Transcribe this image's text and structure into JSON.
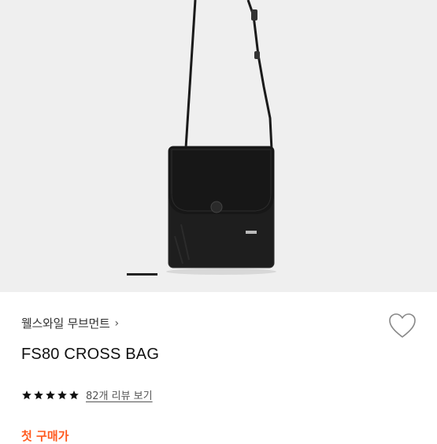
{
  "product": {
    "brand": "웰스와일 무브먼트",
    "brand_chevron": "›",
    "name": "FS80 CROSS BAG",
    "rating_stars": 5,
    "review_link": "82개 리뷰 보기",
    "promo": "첫 구매가"
  },
  "colors": {
    "hero_bg": "#efefef",
    "bag": "#1f1f1f",
    "promo": "#ff5a1f",
    "star": "#111111"
  },
  "carousel": {
    "active_index": 0
  }
}
